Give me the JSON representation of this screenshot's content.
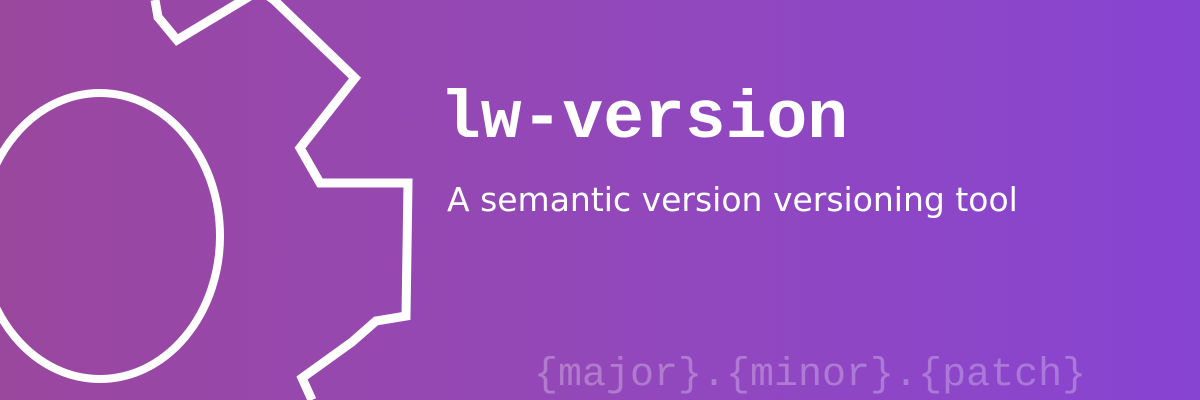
{
  "banner": {
    "title": "lw-version",
    "subtitle": "A semantic version versioning tool",
    "version_format": "{major}.{minor}.{patch}",
    "icon": "gear-icon",
    "colors": {
      "gradient_start": "#9a479e",
      "gradient_end": "#8744d2",
      "text": "#ffffff",
      "format_text": "rgba(255,255,255,0.28)"
    }
  }
}
